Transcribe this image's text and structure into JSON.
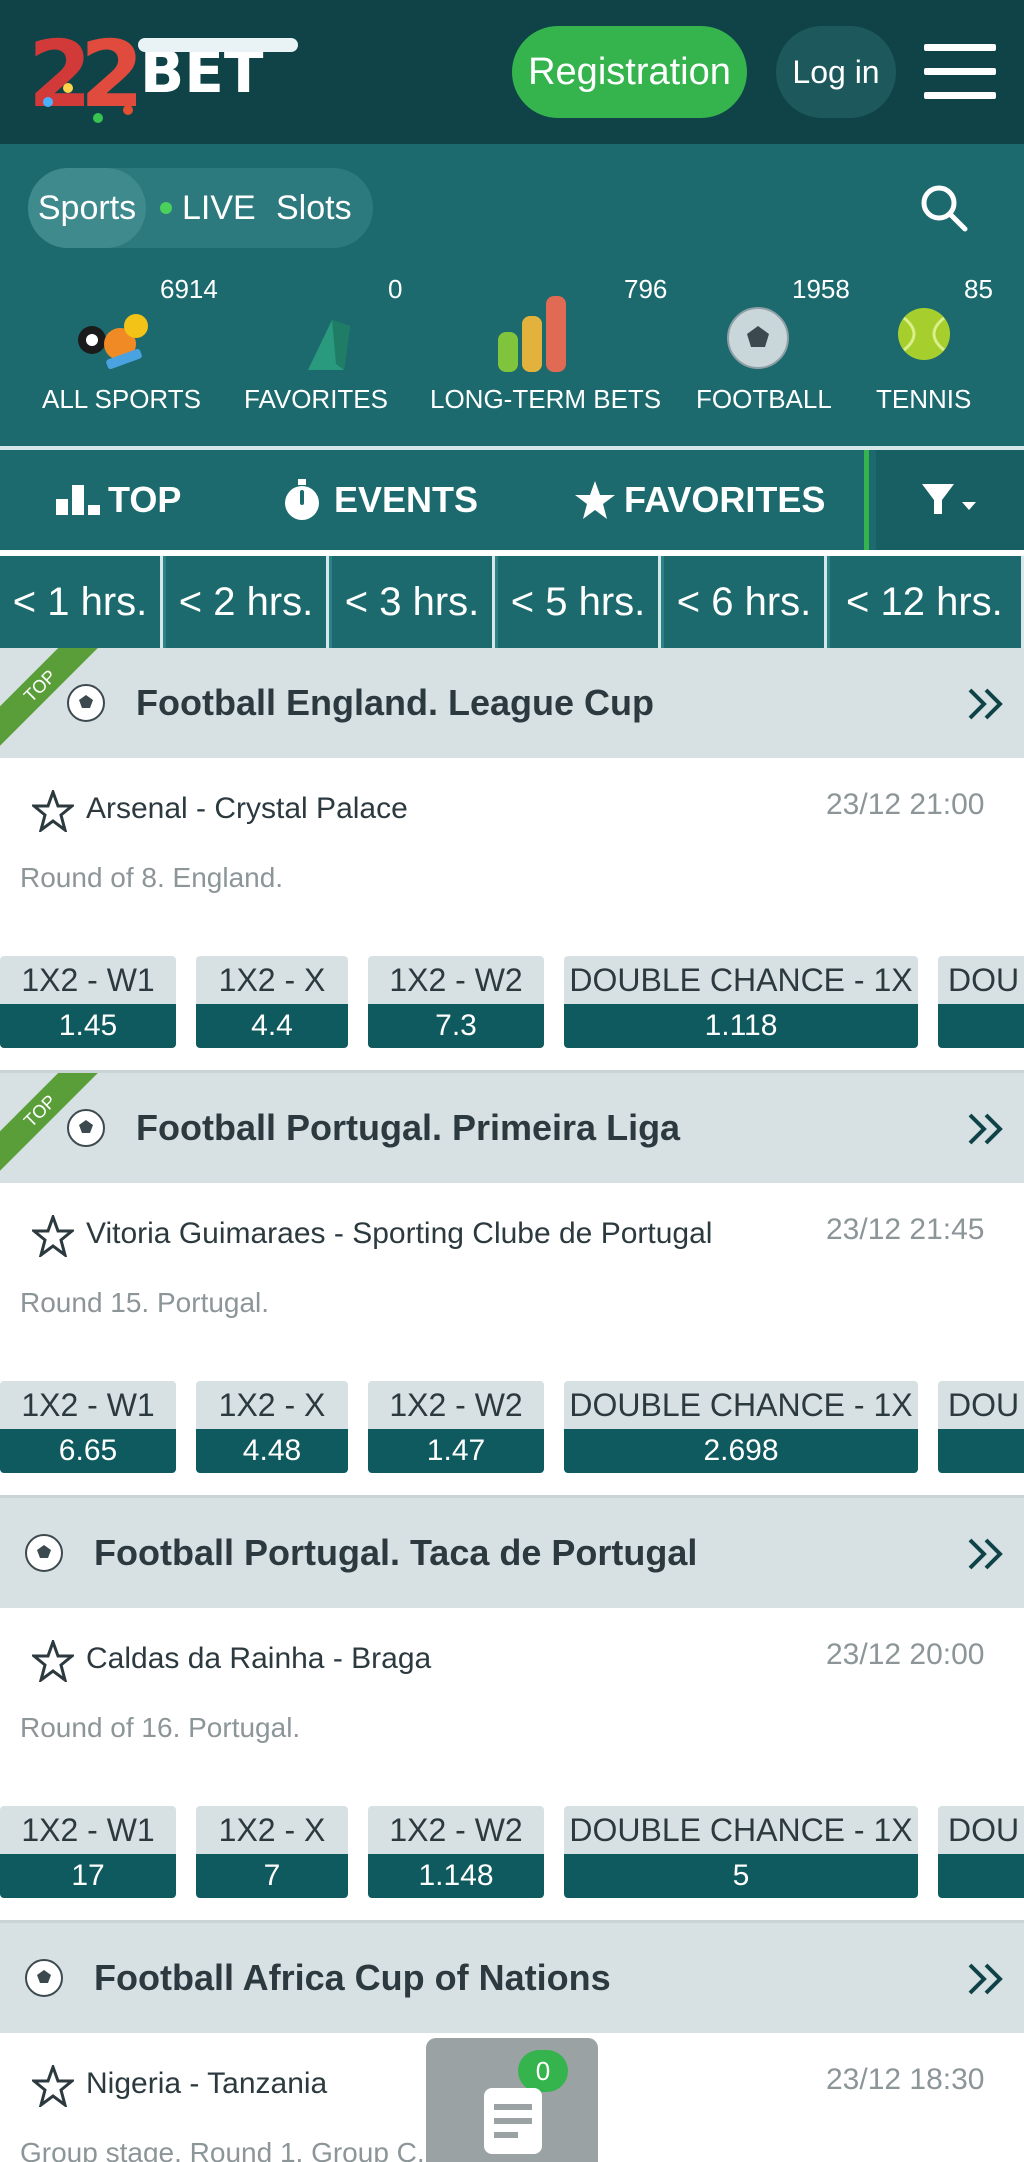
{
  "header": {
    "logo_text": "22BET",
    "registration_label": "Registration",
    "login_label": "Log in"
  },
  "nav": {
    "segments": [
      "Sports",
      "LIVE",
      "Slots"
    ]
  },
  "categories": [
    {
      "label": "ALL SPORTS",
      "count": "6914",
      "icon": "all-sports-icon"
    },
    {
      "label": "FAVORITES",
      "count": "0",
      "icon": "favorites-icon"
    },
    {
      "label": "LONG-TERM BETS",
      "count": "796",
      "icon": "long-term-bets-icon"
    },
    {
      "label": "FOOTBALL",
      "count": "1958",
      "icon": "football-icon"
    },
    {
      "label": "TENNIS",
      "count": "85",
      "icon": "tennis-icon"
    }
  ],
  "tabs": {
    "top": "TOP",
    "events": "EVENTS",
    "favorites": "FAVORITES"
  },
  "time_filters": [
    "< 1 hrs.",
    "< 2 hrs.",
    "< 3 hrs.",
    "< 5 hrs.",
    "< 6 hrs.",
    "< 12 hrs."
  ],
  "top_badge": "TOP",
  "leagues": [
    {
      "name": "Football England. League Cup",
      "top": true,
      "event": {
        "teams": "Arsenal - Crystal Palace",
        "datetime": "23/12 21:00",
        "round": "Round of 8. England.",
        "odds": [
          {
            "label": "1X2 - W1",
            "value": "1.45"
          },
          {
            "label": "1X2 - X",
            "value": "4.4"
          },
          {
            "label": "1X2 - W2",
            "value": "7.3"
          },
          {
            "label": "DOUBLE CHANCE - 1X",
            "value": "1.118"
          },
          {
            "label": "DOU",
            "value": ""
          }
        ]
      }
    },
    {
      "name": "Football Portugal. Primeira Liga",
      "top": true,
      "event": {
        "teams": "Vitoria Guimaraes - Sporting Clube de Portugal",
        "datetime": "23/12 21:45",
        "round": "Round 15. Portugal.",
        "odds": [
          {
            "label": "1X2 - W1",
            "value": "6.65"
          },
          {
            "label": "1X2 - X",
            "value": "4.48"
          },
          {
            "label": "1X2 - W2",
            "value": "1.47"
          },
          {
            "label": "DOUBLE CHANCE - 1X",
            "value": "2.698"
          },
          {
            "label": "DOU",
            "value": ""
          }
        ]
      }
    },
    {
      "name": "Football Portugal. Taca de Portugal",
      "top": false,
      "event": {
        "teams": "Caldas da Rainha - Braga",
        "datetime": "23/12 20:00",
        "round": "Round of 16. Portugal.",
        "odds": [
          {
            "label": "1X2 - W1",
            "value": "17"
          },
          {
            "label": "1X2 - X",
            "value": "7"
          },
          {
            "label": "1X2 - W2",
            "value": "1.148"
          },
          {
            "label": "DOUBLE CHANCE - 1X",
            "value": "5"
          },
          {
            "label": "DOU",
            "value": ""
          }
        ]
      }
    },
    {
      "name": "Football Africa Cup of Nations",
      "top": false,
      "event": {
        "teams": "Nigeria - Tanzania",
        "datetime": "23/12 18:30",
        "round": "Group stage. Round 1. Group C.",
        "odds": []
      }
    }
  ],
  "betslip": {
    "count": "0"
  },
  "colors": {
    "header_bg": "#0f4347",
    "subheader_bg": "#1c6a6e",
    "accent_green": "#35b44e",
    "odds_value_bg": "#0f5a5e",
    "league_bg": "#d7e1e4"
  }
}
